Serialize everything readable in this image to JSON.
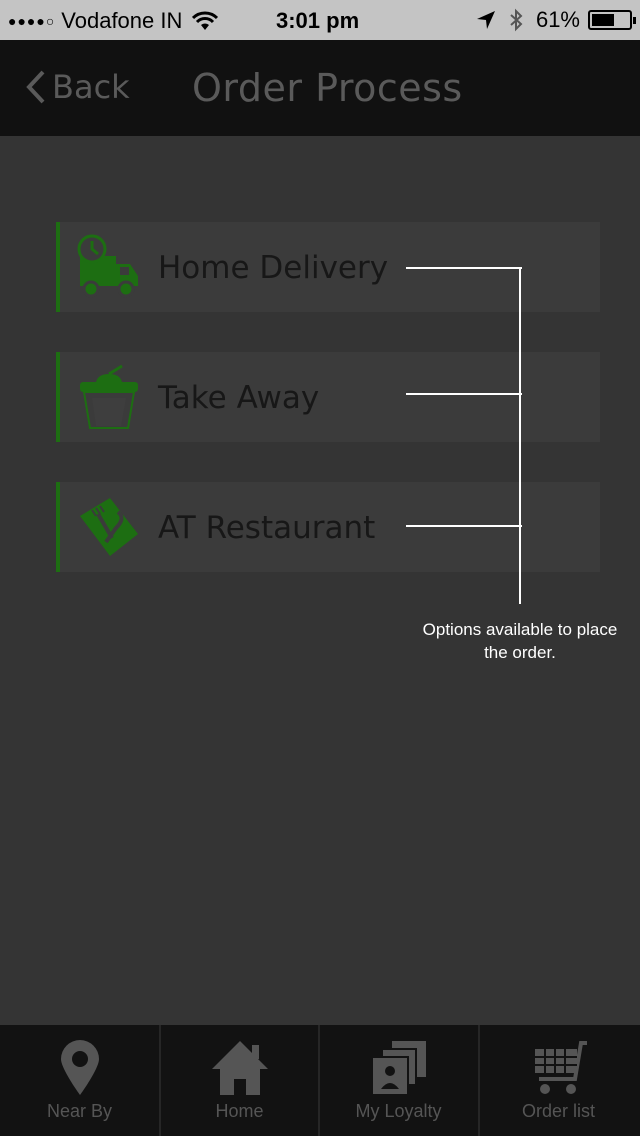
{
  "status_bar": {
    "carrier": "Vodafone IN",
    "time": "3:01 pm",
    "battery": "61%",
    "battery_level": 0.61,
    "signal_dots": "●●●●○"
  },
  "nav": {
    "back_label": "Back",
    "title": "Order Process"
  },
  "options": [
    {
      "label": "Home Delivery",
      "icon": "delivery-truck-icon"
    },
    {
      "label": "Take Away",
      "icon": "takeaway-cup-icon"
    },
    {
      "label": "AT Restaurant",
      "icon": "restaurant-cutlery-icon"
    }
  ],
  "annotation": {
    "text": "Options available to place the order."
  },
  "tabs": [
    {
      "label": "Near By",
      "icon": "location-pin-icon"
    },
    {
      "label": "Home",
      "icon": "home-icon"
    },
    {
      "label": "My Loyalty",
      "icon": "loyalty-cards-icon"
    },
    {
      "label": "Order list",
      "icon": "shopping-cart-icon"
    }
  ],
  "colors": {
    "accent": "#1d6e12",
    "background": "#343434",
    "nav": "#111111"
  }
}
